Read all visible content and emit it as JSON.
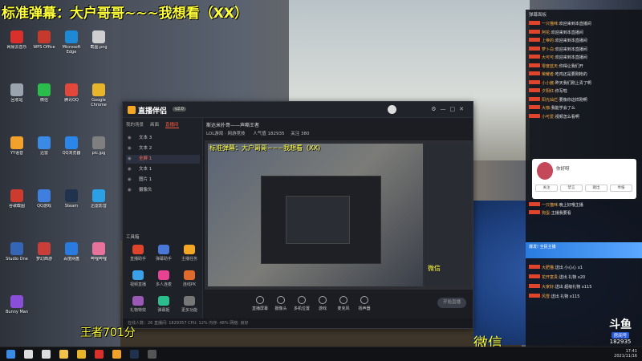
{
  "overlay": {
    "top_danmu": "标准弹幕：大户哥哥~~~我想看（XX）",
    "bottom_left": "王者701分",
    "bottom_right": "微信",
    "preview_right": "微信"
  },
  "desktop_icons": [
    {
      "label": "网易云音乐",
      "color": "#d9302c"
    },
    {
      "label": "WPS Office",
      "color": "#c53a2c"
    },
    {
      "label": "Microsoft Edge",
      "color": "#1e8ad6"
    },
    {
      "label": "截图.png",
      "color": "#cfcfcf"
    },
    {
      "label": "回收站",
      "color": "#9aa4b0"
    },
    {
      "label": "微信",
      "color": "#2bbd4c"
    },
    {
      "label": "腾讯QQ",
      "color": "#e3463b"
    },
    {
      "label": "Google Chrome",
      "color": "#e8b52a"
    },
    {
      "label": "YY语音",
      "color": "#f2a12b"
    },
    {
      "label": "迅雷",
      "color": "#3a8be6"
    },
    {
      "label": "QQ浏览器",
      "color": "#2a86e8"
    },
    {
      "label": "pic.jpg",
      "color": "#7f7f7f"
    },
    {
      "label": "谷歌截图",
      "color": "#cc3b2e"
    },
    {
      "label": "QQ游戏",
      "color": "#3f7fe0"
    },
    {
      "label": "Steam",
      "color": "#20324d"
    },
    {
      "label": "迅雷影音",
      "color": "#2ca0e6"
    },
    {
      "label": "Studio One",
      "color": "#3565b6"
    },
    {
      "label": "梦幻西游",
      "color": "#c83e39"
    },
    {
      "label": "百度网盘",
      "color": "#2a7be0"
    },
    {
      "label": "哔哩哔哩",
      "color": "#e8739a"
    },
    {
      "label": "Bunny Man",
      "color": "#8a4ed8"
    }
  ],
  "app": {
    "logo": "直播伴侣",
    "version": "v2.0",
    "left_tabs": [
      {
        "label": "我的场景"
      },
      {
        "label": "画面"
      },
      {
        "label": "直播间",
        "active": true
      }
    ],
    "scenes": [
      {
        "label": "文本 3"
      },
      {
        "label": "文本 2"
      },
      {
        "label": "全屏 1",
        "selected": true
      },
      {
        "label": "文本 1"
      },
      {
        "label": "图片 1"
      },
      {
        "label": "摄像头"
      }
    ],
    "tools_header": "工具箱",
    "tools": [
      "直播助手",
      "弹幕助手",
      "主播任务",
      "视频直播",
      "多人连麦",
      "连线PK",
      "礼物特效",
      "弹幕姬",
      "更多功能"
    ],
    "stream_title": "斯达米扑哥——声嘶王者",
    "stream_sub": "LOL游戏 · 网游竞技",
    "viewer_label": "人气值",
    "viewer_count": "182935",
    "fans": "关注",
    "fans_count": "380",
    "preview_danmu": "标准弹幕：大户哥哥~~~我想看（XX）",
    "bottom_buttons": [
      "直播屏幕",
      "摄像头",
      "多机位置",
      "游戏",
      "麦克风",
      "扬声器"
    ],
    "start_button": "开始直播",
    "status": "在线人数：26  直播间: 1829357  CPU: 12%  内存: 48%  网络: 良好"
  },
  "chat": {
    "title": "弹幕面板",
    "messages": [
      {
        "user": "一只猫咪:",
        "text": "欢迎来到本直播间"
      },
      {
        "user": "阿花:",
        "text": "欢迎来到本直播间"
      },
      {
        "user": "上帝的:",
        "text": "欢迎来到本直播间"
      },
      {
        "user": "萝卜白:",
        "text": "欢迎来到本直播间"
      },
      {
        "user": "大可可:",
        "text": "欢迎来到本直播间"
      },
      {
        "user": "零度蓝天:",
        "text": "你得让我们开"
      },
      {
        "user": "荣耀者:",
        "text": "吃鸡还是要刚枪的"
      },
      {
        "user": "小小酱:",
        "text": "昨天我们刚上青了啊"
      },
      {
        "user": "夕阳红:",
        "text": "你写啦"
      },
      {
        "user": "阳光灿烂:",
        "text": "要像你这样刚啊"
      },
      {
        "user": "大咖:",
        "text": "我能学会了么"
      },
      {
        "user": "小可爱:",
        "text": "视频怎么看啊"
      },
      {
        "user": "一只猫咪:",
        "text": "晚上好哦主播"
      },
      {
        "user": "狗蛋:",
        "text": "主播我要看"
      },
      {
        "user": "大肥猫:",
        "text": "送出 小心心 x1"
      },
      {
        "user": "花开富贵:",
        "text": "送出 礼物 x20"
      },
      {
        "user": "大家好:",
        "text": "送出 超级礼物 x115"
      },
      {
        "user": "风雪:",
        "text": "送出 礼物 x115"
      }
    ],
    "card": {
      "name": "你好呀",
      "buttons": [
        "关注",
        "禁言",
        "踢出",
        "举报"
      ]
    },
    "gift_banner": "爆发! 全民主播",
    "room_logo": "斗鱼",
    "room_tag": "房间号",
    "room_number": "182935"
  },
  "taskbar": {
    "time": "17:41",
    "date": "2021/11/16",
    "icons": [
      "windows-start",
      "search",
      "task-view",
      "explorer",
      "chrome",
      "netease",
      "douyu",
      "steam",
      "obs"
    ]
  }
}
